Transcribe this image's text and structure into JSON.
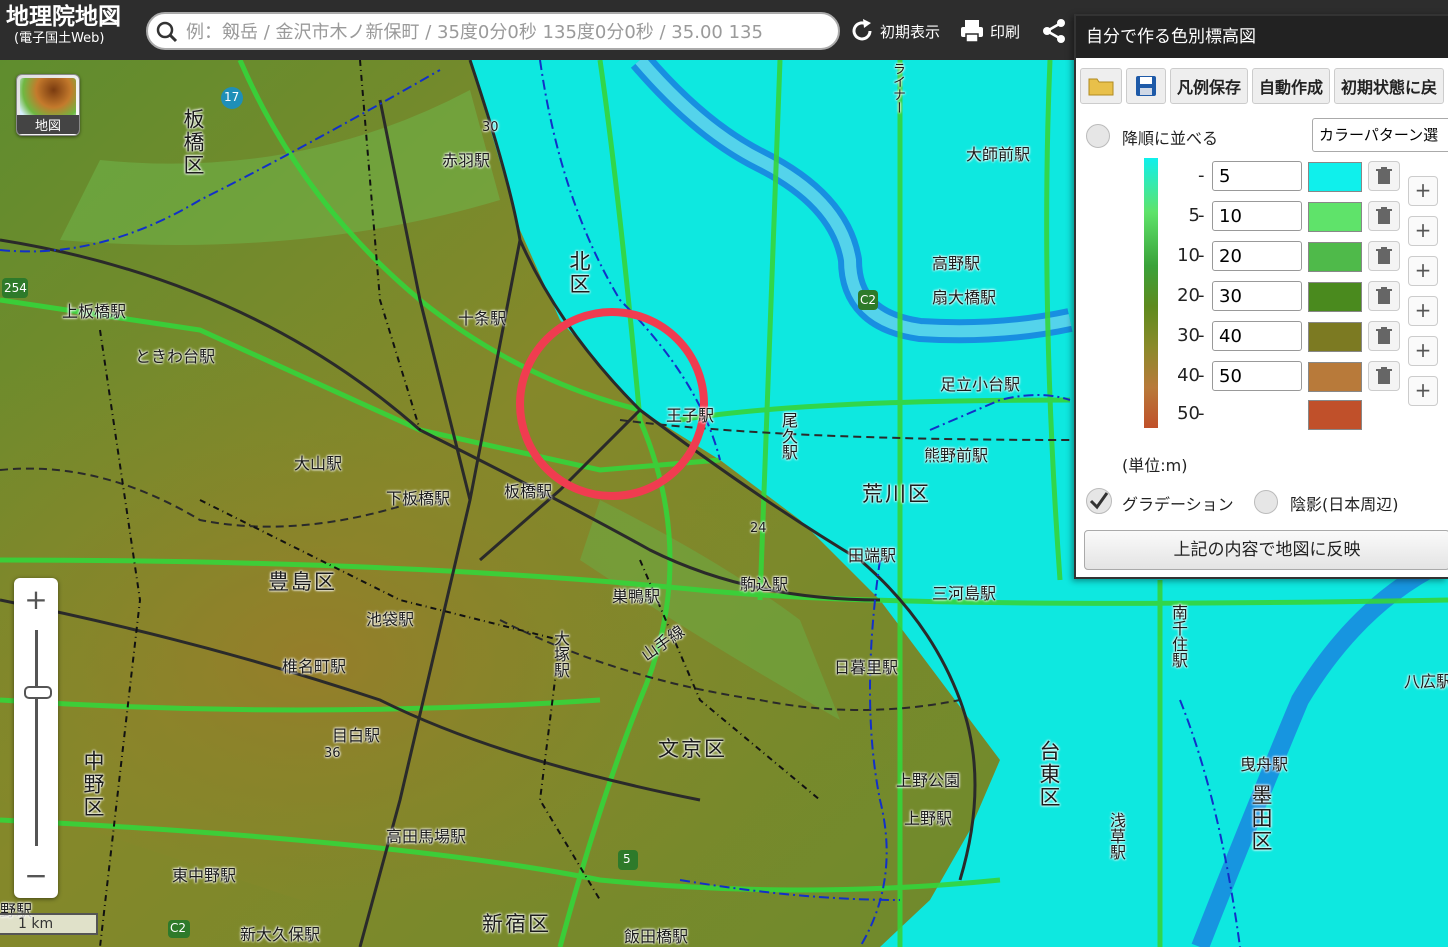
{
  "app": {
    "title": "地理院地図",
    "subtitle": "(電子国土Web)"
  },
  "search": {
    "placeholder": "例：剱岳 / 金沢市木ノ新保町 / 35度0分0秒 135度0分0秒 / 35.00 135"
  },
  "toolbar": {
    "reset_label": "初期表示",
    "print_label": "印刷"
  },
  "map_thumb": {
    "label": "地図"
  },
  "scale": {
    "label": "1 km"
  },
  "map": {
    "wards": [
      {
        "text": "板橋区",
        "vertical": true
      },
      {
        "text": "北区",
        "vertical": true
      },
      {
        "text": "荒川区",
        "vertical": false
      },
      {
        "text": "豊島区",
        "vertical": false
      },
      {
        "text": "文京区",
        "vertical": false
      },
      {
        "text": "中野区",
        "vertical": true
      },
      {
        "text": "新宿区",
        "vertical": false
      },
      {
        "text": "台東区",
        "vertical": true
      },
      {
        "text": "墨田区",
        "vertical": true
      }
    ],
    "stations": [
      "赤羽駅",
      "十条駅",
      "上板橋駅",
      "ときわ台駅",
      "大山駅",
      "下板橋駅",
      "板橋駅",
      "王子駅",
      "尾久駅",
      "熊野前駅",
      "高野駅",
      "扇大橋駅",
      "大師前駅",
      "足立小台駅",
      "田端駅",
      "三河島駅",
      "駒込駅",
      "巣鴨駅",
      "大塚駅",
      "池袋駅",
      "椎名町駅",
      "目白駅",
      "高田馬場駅",
      "東中野駅",
      "新大久保駅",
      "飯田橋駅",
      "日暮里駅",
      "上野公園",
      "上野駅",
      "南千住駅",
      "浅草駅",
      "曳舟駅",
      "八広駅",
      "野駅"
    ],
    "misc_labels": [
      "山手線",
      "ライナー",
      "30",
      "24",
      "36"
    ],
    "route_shields": [
      "17",
      "254",
      "C2",
      "5",
      "C2"
    ],
    "colors": {
      "lowland": "#0ee8e0",
      "upland": "#7f8a2a",
      "road": "#38d43a",
      "rail": "#2a2a2a",
      "river": "#1a7fe0",
      "highlight_circle": "#f03c50"
    }
  },
  "panel": {
    "title": "自分で作る色別標高図",
    "toolbar": {
      "open_icon": "folder-icon",
      "save_icon": "floppy-disk-icon",
      "save_legend": "凡例保存",
      "auto_create": "自動作成",
      "reset_initial": "初期状態に戻"
    },
    "sort_desc_label": "降順に並べる",
    "color_pattern_label": "カラーパターン選",
    "rows": [
      {
        "from": "",
        "value": "5",
        "color": "#0ff0ec"
      },
      {
        "from": "5",
        "value": "10",
        "color": "#5fe36a"
      },
      {
        "from": "10",
        "value": "20",
        "color": "#4fba4a"
      },
      {
        "from": "20",
        "value": "30",
        "color": "#4a8a1e"
      },
      {
        "from": "30",
        "value": "40",
        "color": "#7c7a22"
      },
      {
        "from": "40",
        "value": "50",
        "color": "#b87a3a"
      },
      {
        "from": "50",
        "value": "",
        "color": "#c0502a"
      }
    ],
    "unit_label": "(単位:m)",
    "gradation_label": "グラデーション",
    "gradation_checked": true,
    "shade_label": "陰影(日本周辺)",
    "apply_label": "上記の内容で地図に反映"
  }
}
